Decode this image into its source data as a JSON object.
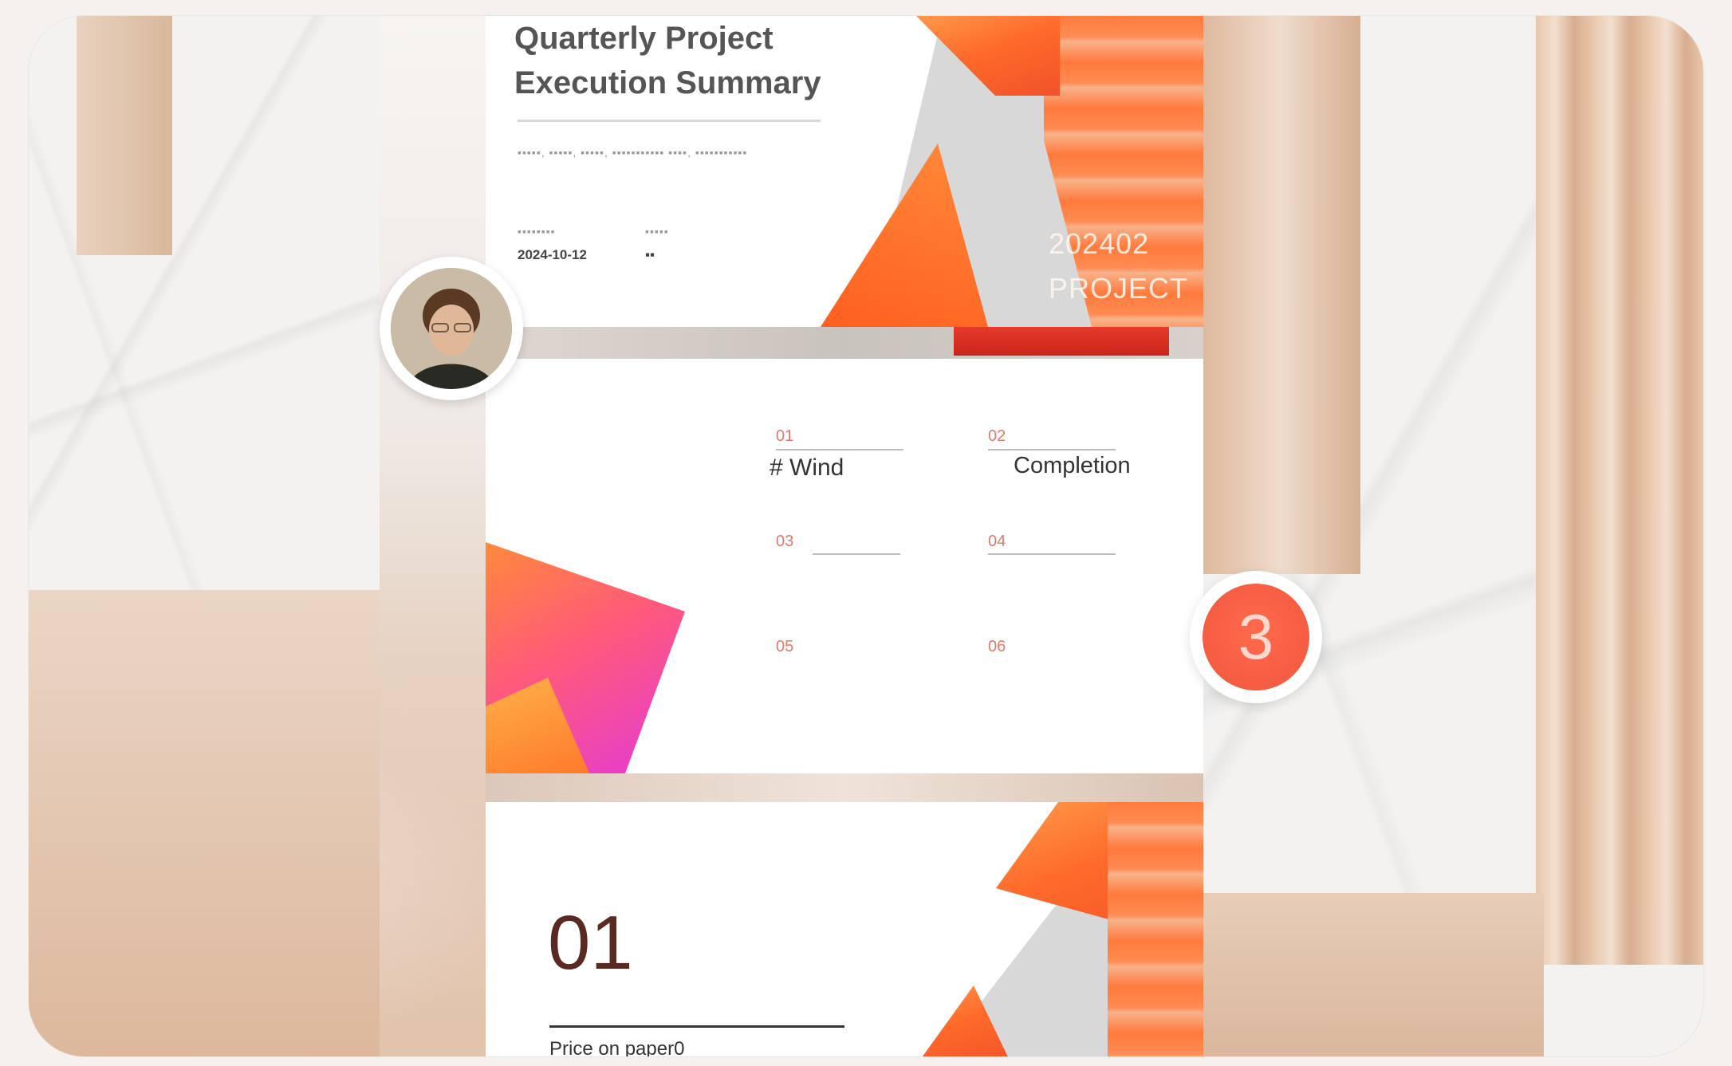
{
  "cover_slide": {
    "title_line1": "Quarterly Project",
    "title_line2": "Execution Summary",
    "subtitle_placeholder": "▪▪▪▪▪, ▪▪▪▪▪, ▪▪▪▪▪, ▪▪▪▪▪▪▪▪▪▪▪ ▪▪▪▪, ▪▪▪▪▪▪▪▪▪▪▪",
    "meta_label_date": "▪▪▪▪▪▪▪▪",
    "meta_value_date": "2024-10-12",
    "meta_label_author": "▪▪▪▪▪",
    "meta_value_author": "▪▪",
    "code_line1": "202402",
    "code_line2": "PROJECT"
  },
  "agenda_slide": {
    "items": [
      {
        "num": "01",
        "label": "# Wind"
      },
      {
        "num": "02",
        "label": "Completion"
      },
      {
        "num": "03",
        "label": ""
      },
      {
        "num": "04",
        "label": ""
      },
      {
        "num": "05",
        "label": ""
      },
      {
        "num": "06",
        "label": ""
      }
    ]
  },
  "section_slide": {
    "number": "01",
    "caption": "Price on paper0"
  },
  "badge": {
    "count": "3"
  },
  "colors": {
    "accent": "#f1563e",
    "orange": "#ff6a2a",
    "magenta": "#e33ad6",
    "peach": "#e2c3ac"
  }
}
